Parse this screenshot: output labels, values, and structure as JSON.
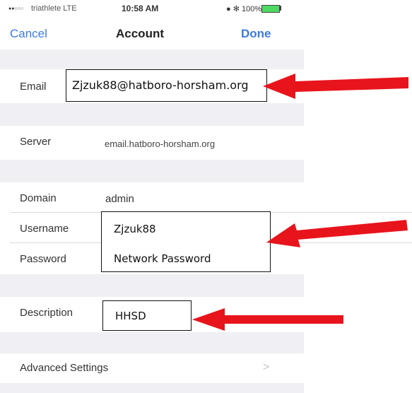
{
  "status_bar": {
    "signal": "●●○○○",
    "carrier": "triathlete  LTE",
    "time": "10:58 AM",
    "battery": "● ✻ 100%"
  },
  "nav": {
    "cancel": "Cancel",
    "title": "Account",
    "done": "Done"
  },
  "fields": {
    "email_label": "Email",
    "email_value": "Zjzuk88@hatboro-horsham.org",
    "server_label": "Server",
    "server_value": "email.hatboro-horsham.org",
    "domain_label": "Domain",
    "domain_value": "admin",
    "username_label": "Username",
    "username_value": "Zjzuk88",
    "password_label": "Password",
    "password_value": "Network Password",
    "description_label": "Description",
    "description_value": "HHSD",
    "advanced_label": "Advanced Settings",
    "advanced_chevron": ">"
  },
  "colors": {
    "accent": "#3b7bdc",
    "arrow": "#e8141c",
    "group_bg": "#efeff4"
  }
}
